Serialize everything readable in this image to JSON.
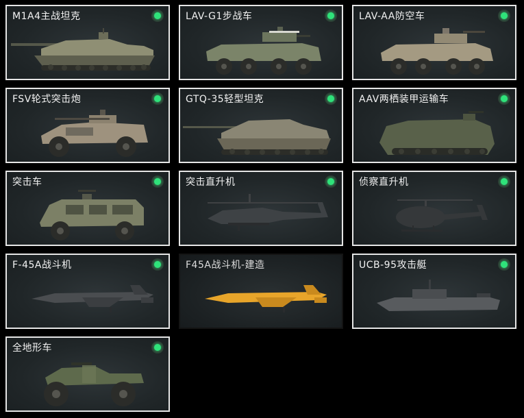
{
  "vehicles": [
    {
      "name": "M1A4主战坦克",
      "icon": "tank-icon",
      "status": "selected"
    },
    {
      "name": "LAV-G1步战车",
      "icon": "ifv-icon",
      "status": "selected"
    },
    {
      "name": "LAV-AA防空车",
      "icon": "aa-vehicle-icon",
      "status": "selected"
    },
    {
      "name": "FSV轮式突击炮",
      "icon": "assault-gun-icon",
      "status": "selected"
    },
    {
      "name": "GTQ-35轻型坦克",
      "icon": "light-tank-icon",
      "status": "selected"
    },
    {
      "name": "AAV两栖装甲运输车",
      "icon": "amphibious-apc-icon",
      "status": "selected"
    },
    {
      "name": "突击车",
      "icon": "armored-car-icon",
      "status": "selected"
    },
    {
      "name": "突击直升机",
      "icon": "attack-helicopter-icon",
      "status": "selected"
    },
    {
      "name": "侦察直升机",
      "icon": "scout-helicopter-icon",
      "status": "selected"
    },
    {
      "name": "F-45A战斗机",
      "icon": "fighter-jet-icon",
      "status": "selected"
    },
    {
      "name": "F45A战斗机-建造",
      "icon": "fighter-jet-build-icon",
      "status": "locked"
    },
    {
      "name": "UCB-95攻击艇",
      "icon": "attack-boat-icon",
      "status": "selected"
    },
    {
      "name": "全地形车",
      "icon": "atv-icon",
      "status": "selected"
    }
  ],
  "colors": {
    "status_dot": "#2fe27a",
    "card_border": "#e6e6e6",
    "build_jet": "#e8a52a"
  }
}
